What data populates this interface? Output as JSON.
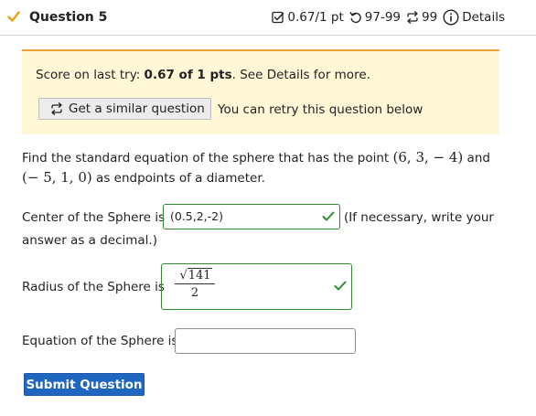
{
  "header": {
    "title": "Question 5",
    "points": "0.67/1 pt",
    "attempts": "97-99",
    "retries": "99",
    "details": "Details"
  },
  "banner": {
    "score_prefix": "Score on last try: ",
    "score_value": "0.67 of 1 pts",
    "score_suffix": ". See Details for more.",
    "similar_button": "Get a similar question",
    "retry_text": "You can retry this question below"
  },
  "question": {
    "text_before": "Find the standard equation of the sphere that has the point ",
    "point1": "(6, 3, − 4)",
    "text_mid": " and ",
    "point2": "(− 5, 1, 0)",
    "text_after": " as endpoints of a diameter."
  },
  "center": {
    "label": "Center of the Sphere is",
    "value": "(0.5,2,-2)",
    "note_line1": "(If necessary, write your",
    "note_line2": "answer as a decimal.)"
  },
  "radius": {
    "label": "Radius of the Sphere is",
    "numerator": "141",
    "denominator": "2"
  },
  "equation": {
    "label": "Equation of the Sphere is",
    "value": ""
  },
  "submit": {
    "label": "Submit Question"
  },
  "colors": {
    "accent_gold": "#e8a317",
    "correct_green": "#2e8b2e",
    "banner_bg": "#fff7d6",
    "banner_border": "#f0a030",
    "submit_blue": "#1f66c1"
  },
  "icons": {
    "status": "check-icon",
    "points": "checkbox-check-icon",
    "attempts": "retry-arrow-icon",
    "retries": "repeat-arrows-icon",
    "details": "info-circle-icon"
  }
}
